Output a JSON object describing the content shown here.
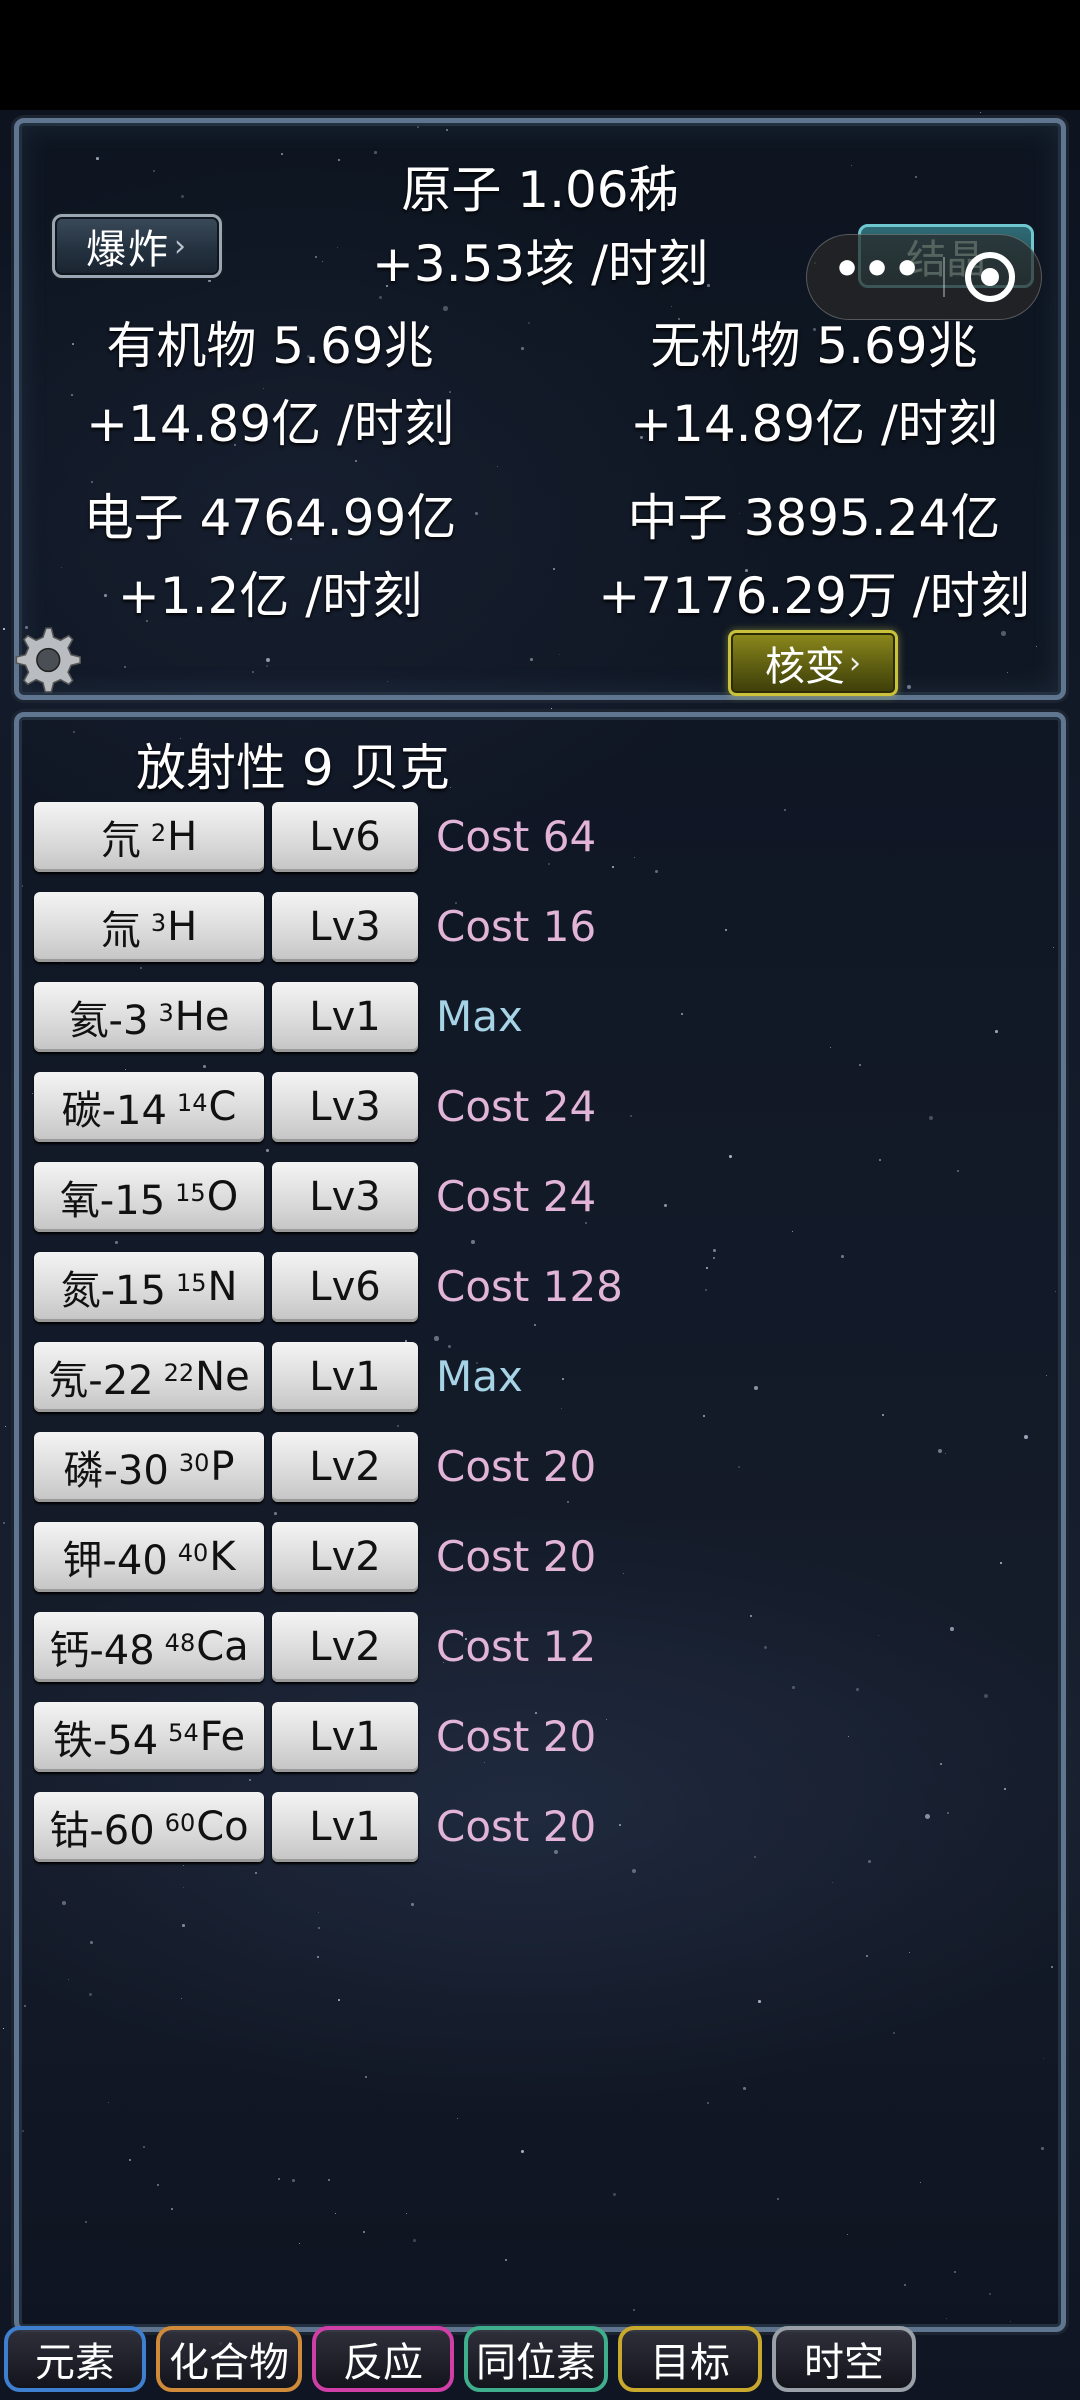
{
  "header": {
    "atom_line": "原子 1.06秭",
    "atom_rate": "+3.53垓 /时刻",
    "explode_label": "爆炸",
    "crystal_label": "结晶",
    "capsule_dots": "•••",
    "organic_line": "有机物 5.69兆",
    "organic_rate": "+14.89亿 /时刻",
    "inorganic_line": "无机物 5.69兆",
    "inorganic_rate": "+14.89亿 /时刻",
    "electron_line": "电子 4764.99亿",
    "electron_rate": "+1.2亿 /时刻",
    "neutron_line": "中子 3895.24亿",
    "neutron_rate": "+7176.29万 /时刻",
    "fission_label": "核变"
  },
  "radio": {
    "title": "放射性 9 贝克",
    "items": [
      {
        "name": "氘",
        "mass": "2",
        "sym": "H",
        "level": "Lv6",
        "cost": "Cost 64"
      },
      {
        "name": "氚",
        "mass": "3",
        "sym": "H",
        "level": "Lv3",
        "cost": "Cost 16"
      },
      {
        "name": "氦-3",
        "mass": "3",
        "sym": "He",
        "level": "Lv1",
        "cost": "Max"
      },
      {
        "name": "碳-14",
        "mass": "14",
        "sym": "C",
        "level": "Lv3",
        "cost": "Cost 24"
      },
      {
        "name": "氧-15",
        "mass": "15",
        "sym": "O",
        "level": "Lv3",
        "cost": "Cost 24"
      },
      {
        "name": "氮-15",
        "mass": "15",
        "sym": "N",
        "level": "Lv6",
        "cost": "Cost 128"
      },
      {
        "name": "氖-22",
        "mass": "22",
        "sym": "Ne",
        "level": "Lv1",
        "cost": "Max"
      },
      {
        "name": "磷-30",
        "mass": "30",
        "sym": "P",
        "level": "Lv2",
        "cost": "Cost 20"
      },
      {
        "name": "钾-40",
        "mass": "40",
        "sym": "K",
        "level": "Lv2",
        "cost": "Cost 20"
      },
      {
        "name": "钙-48",
        "mass": "48",
        "sym": "Ca",
        "level": "Lv2",
        "cost": "Cost 12"
      },
      {
        "name": "铁-54",
        "mass": "54",
        "sym": "Fe",
        "level": "Lv1",
        "cost": "Cost 20"
      },
      {
        "name": "钴-60",
        "mass": "60",
        "sym": "Co",
        "level": "Lv1",
        "cost": "Cost 20"
      }
    ]
  },
  "tabs": [
    {
      "label": "元素",
      "color": "#3f7fd0"
    },
    {
      "label": "化合物",
      "color": "#d08a3a"
    },
    {
      "label": "反应",
      "color": "#cf3fa6"
    },
    {
      "label": "同位素",
      "color": "#3fae8c"
    },
    {
      "label": "目标",
      "color": "#c9a82e"
    },
    {
      "label": "时空",
      "color": "#9aa0a8"
    }
  ]
}
